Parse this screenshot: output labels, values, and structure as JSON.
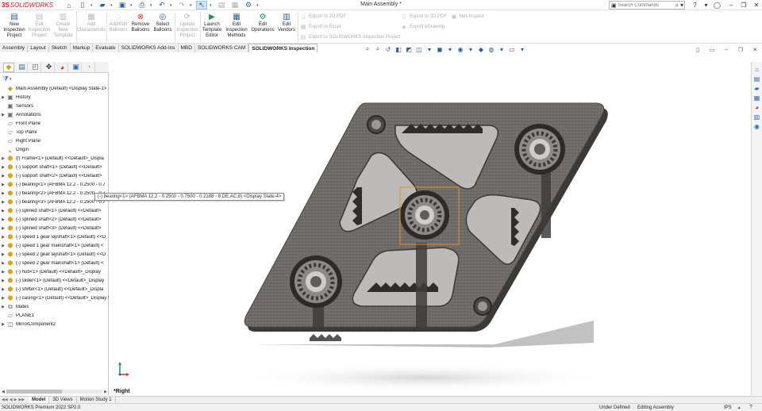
{
  "app": {
    "brand_prefix": "3S",
    "brand_name": "SOLIDWORKS",
    "document_title": "Main Assembly *",
    "search_placeholder": "Search Commands"
  },
  "ribbon": {
    "large_buttons": [
      {
        "id": "new-inspection-project",
        "label": "New Inspection Project",
        "enabled": true,
        "icon": "new-project-icon"
      },
      {
        "id": "edit-inspection-project",
        "label": "Edit Inspection Project",
        "enabled": false,
        "icon": "edit-project-icon"
      },
      {
        "id": "create-new-template",
        "label": "Create New Template",
        "enabled": false,
        "icon": "template-icon"
      },
      {
        "id": "add-characteristic",
        "label": "Add Characteristic",
        "enabled": false,
        "icon": "add-characteristic-icon"
      },
      {
        "id": "add-edit-balloons",
        "label": "Add/Edit Balloons",
        "enabled": false,
        "icon": "balloon-icon"
      },
      {
        "id": "remove-balloons",
        "label": "Remove Balloons",
        "enabled": true,
        "icon": "remove-balloon-icon"
      },
      {
        "id": "select-balloons",
        "label": "Select Balloons",
        "enabled": true,
        "icon": "select-balloon-icon"
      },
      {
        "id": "update-inspection-project",
        "label": "Update Inspection Project",
        "enabled": false,
        "icon": "update-icon"
      },
      {
        "id": "launch-template-editor",
        "label": "Launch Template Editor",
        "enabled": true,
        "icon": "template-editor-icon"
      },
      {
        "id": "edit-inspection-methods",
        "label": "Edit Inspection Methods",
        "enabled": true,
        "icon": "methods-icon"
      },
      {
        "id": "edit-operations",
        "label": "Edit Operations",
        "enabled": true,
        "icon": "operations-icon"
      },
      {
        "id": "edit-vendors",
        "label": "Edit Vendors",
        "enabled": true,
        "icon": "vendors-icon"
      }
    ],
    "export_buttons": [
      {
        "id": "export-2d-pdf",
        "label": "Export to 2D PDF"
      },
      {
        "id": "export-excel",
        "label": "Export to Excel"
      },
      {
        "id": "export-inspection-project",
        "label": "Export to SOLIDWORKS Inspection Project"
      },
      {
        "id": "export-3d-pdf",
        "label": "Export to 3D PDF"
      },
      {
        "id": "export-edrawing",
        "label": "Export eDrawing"
      },
      {
        "id": "net-inspect",
        "label": "Net-Inspect"
      }
    ]
  },
  "command_tabs": [
    {
      "label": "Assembly",
      "active": false
    },
    {
      "label": "Layout",
      "active": false
    },
    {
      "label": "Sketch",
      "active": false
    },
    {
      "label": "Markup",
      "active": false
    },
    {
      "label": "Evaluate",
      "active": false
    },
    {
      "label": "SOLIDWORKS Add-Ins",
      "active": false
    },
    {
      "label": "MBD",
      "active": false
    },
    {
      "label": "SOLIDWORKS CAM",
      "active": false
    },
    {
      "label": "SOLIDWORKS Inspection",
      "active": true
    }
  ],
  "feature_tree": {
    "root": "Main Assembly (Default) <Display State-1>",
    "items": [
      {
        "label": "History",
        "icon": "folder",
        "expand": true
      },
      {
        "label": "Sensors",
        "icon": "folder",
        "expand": false
      },
      {
        "label": "Annotations",
        "icon": "folder",
        "expand": true
      },
      {
        "label": "Front Plane",
        "icon": "plane",
        "expand": false
      },
      {
        "label": "Top Plane",
        "icon": "plane",
        "expand": false
      },
      {
        "label": "Right Plane",
        "icon": "plane",
        "expand": false
      },
      {
        "label": "Origin",
        "icon": "origin",
        "expand": false
      },
      {
        "label": "(f) Frame<1> (Default) <<Default>_Displa",
        "icon": "part",
        "expand": true
      },
      {
        "label": "(-) support shaft<1> (Default) <<Default>",
        "icon": "part",
        "expand": true
      },
      {
        "label": "(-) support shaft<2> (Default) <<Default>",
        "icon": "part",
        "expand": true
      },
      {
        "label": "(-) bearing<1> (AFBMA 12.2 - 0.2500 - 0.7",
        "icon": "part",
        "expand": true
      },
      {
        "label": "(-) bearing<2> (AFBMA 12.2 - 0.2500 - 0.7",
        "icon": "part",
        "expand": true
      },
      {
        "label": "(-) bearing<3> (AFBMA 12.2 - 0.2500 - 0.7",
        "icon": "part",
        "expand": true
      },
      {
        "label": "(-) splined shaft<1> (Default) <<Default>",
        "icon": "part",
        "expand": true
      },
      {
        "label": "(-) splined shaft<2> (Default) <<Default>",
        "icon": "part",
        "expand": true
      },
      {
        "label": "(-) splined shaft<3> (Default) <<Default>",
        "icon": "part",
        "expand": true
      },
      {
        "label": "(-) speed 1 gear layshaft<1> (Default) <<D",
        "icon": "part",
        "expand": true
      },
      {
        "label": "(-) speed 1 gear mainshaft<1> (Default) <",
        "icon": "part",
        "expand": true
      },
      {
        "label": "(-) speed 2 gear layshaft<1> (Default) <<D",
        "icon": "part",
        "expand": true
      },
      {
        "label": "(-) speed 2 gear mainshaft<1> (Default) <",
        "icon": "part",
        "expand": true
      },
      {
        "label": "(-) hub<1> (Default) <<Default>_Display",
        "icon": "part",
        "expand": true
      },
      {
        "label": "(-) slider<1> (Default) <<Default>_Display",
        "icon": "part",
        "expand": true
      },
      {
        "label": "(-) shifter<1> (Default) <<Default>_Displa",
        "icon": "part",
        "expand": true
      },
      {
        "label": "(-) casing<1> (Default) <<Default>_Display S",
        "icon": "part",
        "expand": true
      },
      {
        "label": "Mates",
        "icon": "mates",
        "expand": true
      },
      {
        "label": "PLANE1",
        "icon": "plane",
        "expand": false
      },
      {
        "label": "MirrorComponent2",
        "icon": "mirror",
        "expand": true
      }
    ]
  },
  "graphics": {
    "tooltip": "(-) bearing<1> (AFBMA 12.2 - 0.2500 - 0.7500 - 0.2188 - 8,DE,AC,8) <Display State-4>",
    "view_label": "*Right"
  },
  "bottom_tabs": [
    {
      "label": "Model",
      "active": true
    },
    {
      "label": "3D Views",
      "active": false
    },
    {
      "label": "Motion Study 1",
      "active": false
    }
  ],
  "status": {
    "product": "SOLIDWORKS Premium 2022 SP2.0",
    "defined": "Under Defined",
    "mode": "Editing Assembly",
    "units": "IPS"
  },
  "colors": {
    "brand_red": "#d71920",
    "accent_blue": "#2b5d9b",
    "part_yellow": "#d9a520",
    "casing_fill": "#6e6a68",
    "selection_orange": "#e0902a"
  }
}
